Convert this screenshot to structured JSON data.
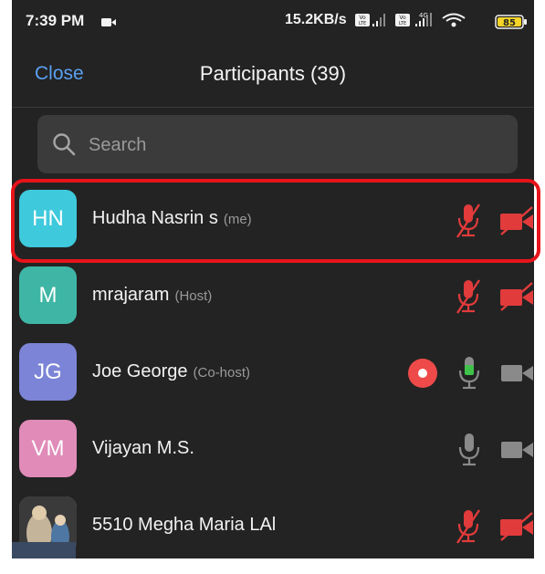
{
  "status_bar": {
    "time": "7:39 PM",
    "net_speed": "15.2KB/s",
    "battery": "85"
  },
  "nav": {
    "close_label": "Close",
    "title": "Participants (39)"
  },
  "search": {
    "placeholder": "Search"
  },
  "participants": [
    {
      "initials": "HN",
      "name": "Hudha Nasrin s",
      "role": "(me)",
      "avatar_color": "#3ec9dc",
      "mic": "muted",
      "video": "off",
      "highlighted": true
    },
    {
      "initials": "M",
      "name": "mrajaram",
      "role": "(Host)",
      "avatar_color": "#3fb6a5",
      "mic": "muted",
      "video": "off"
    },
    {
      "initials": "JG",
      "name": "Joe George",
      "role": "(Co-host)",
      "avatar_color": "#7b84d6",
      "mic": "active",
      "video": "on",
      "recording": true
    },
    {
      "initials": "VM",
      "name": "Vijayan M.S.",
      "role": "",
      "avatar_color": "#e08bb8",
      "mic": "on",
      "video": "on"
    },
    {
      "initials": "",
      "name": "5510 Megha Maria LAl",
      "role": "",
      "avatar": "photo",
      "mic": "muted",
      "video": "off"
    }
  ],
  "colors": {
    "background": "#232323",
    "accent": "#5aa0f2",
    "muted_red": "#e23b3b",
    "active_green": "#3fc24a",
    "highlight_border": "#e8131a"
  },
  "icons": [
    "video-call-icon",
    "signal-icon",
    "wifi-icon",
    "battery-icon",
    "search-icon",
    "mic-muted-icon",
    "video-off-icon",
    "record-icon",
    "mic-active-icon",
    "mic-icon",
    "video-icon"
  ]
}
